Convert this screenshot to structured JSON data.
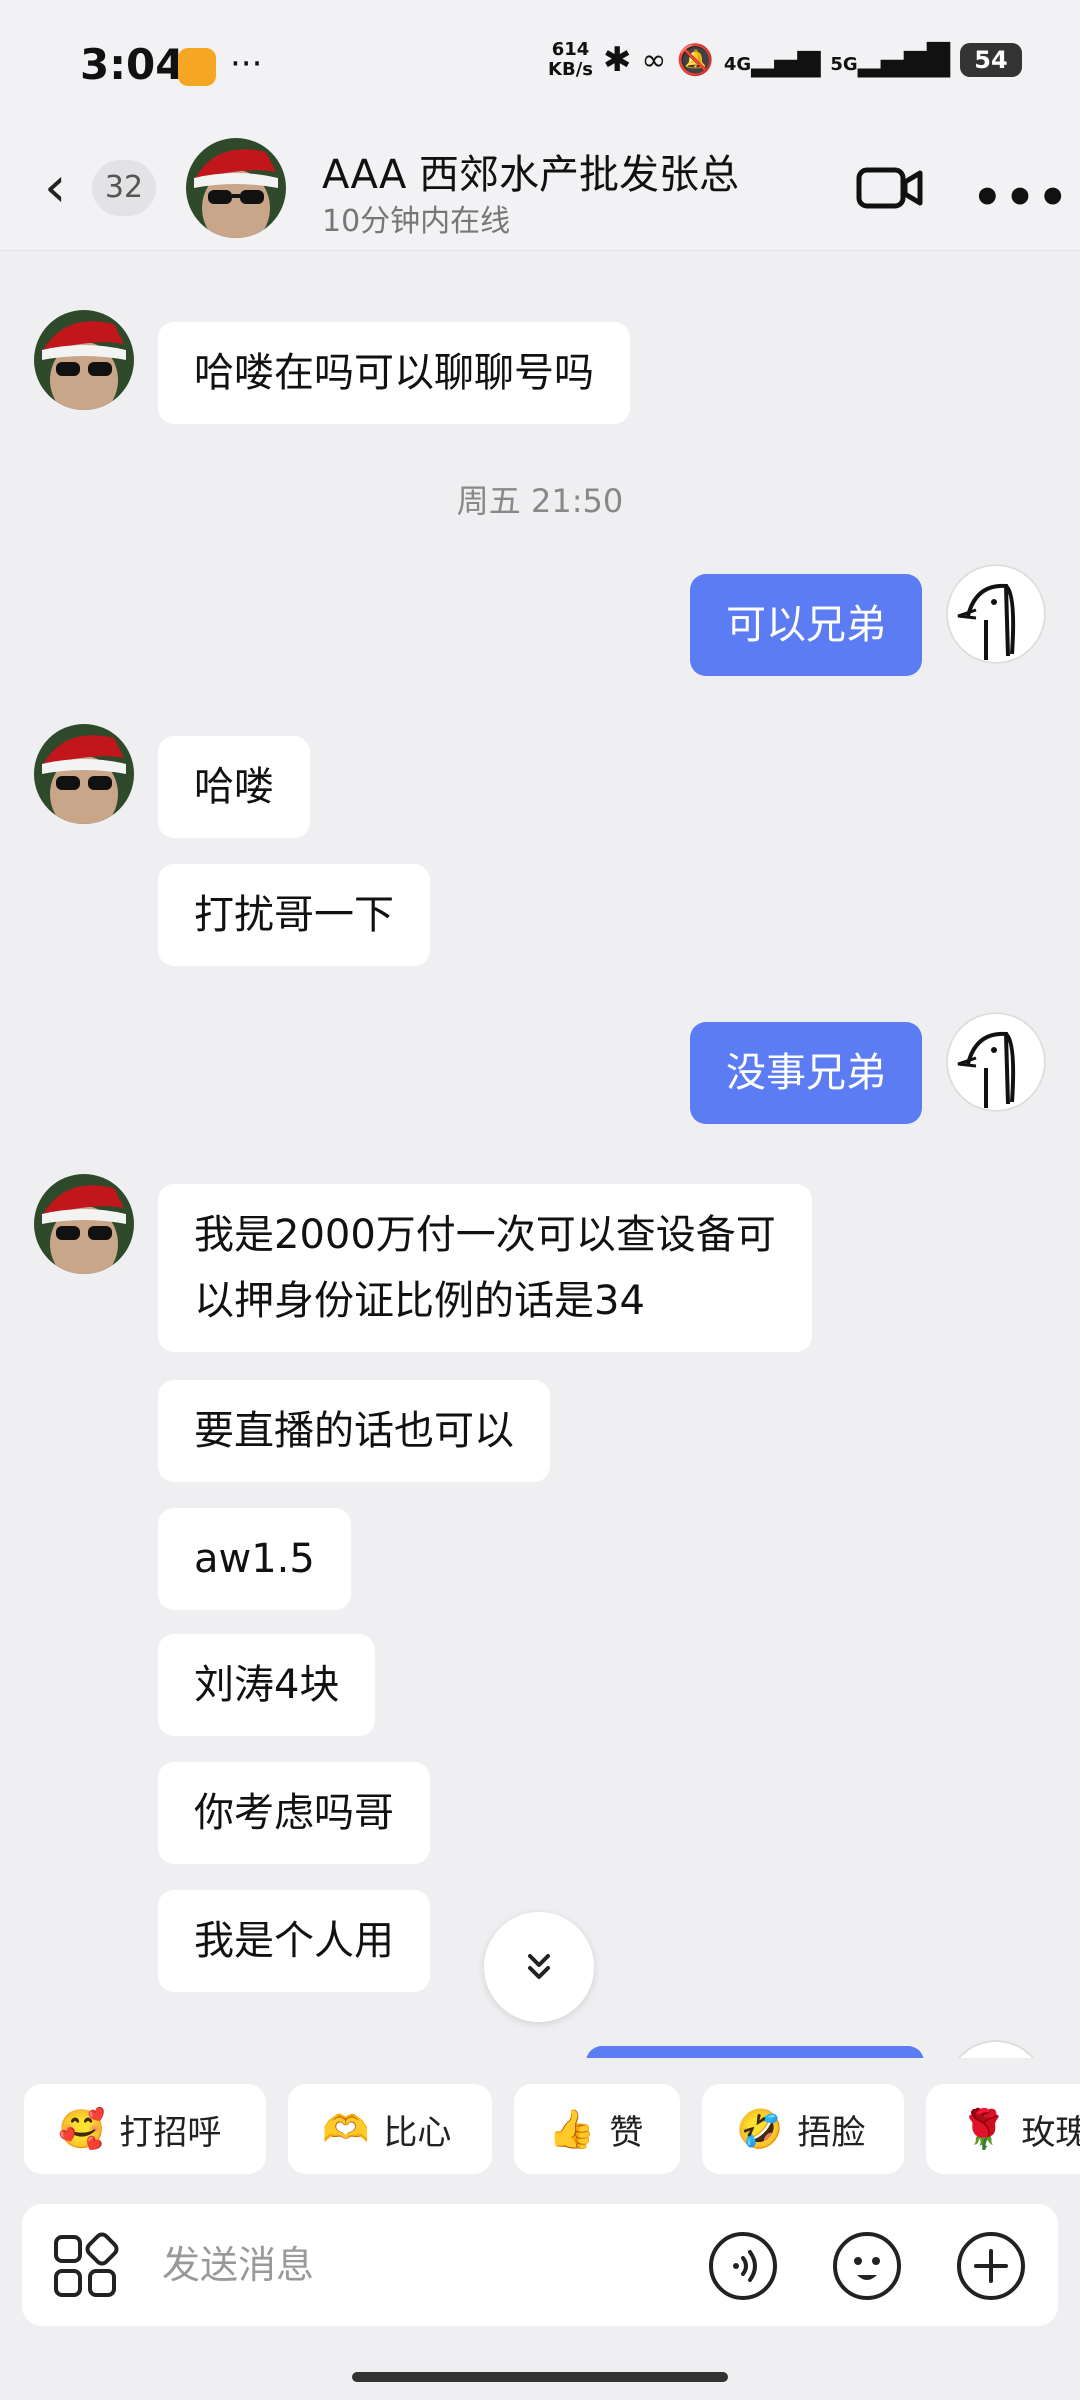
{
  "status_bar": {
    "time": "3:04",
    "net_speed_value": "614",
    "net_speed_unit": "KB/s",
    "signal_labels": [
      "4G",
      "5G"
    ],
    "battery": "54"
  },
  "header": {
    "unread_count": "32",
    "contact_name": "AAA 西郊水产批发张总",
    "contact_status": "10分钟内在线"
  },
  "messages": [
    {
      "id": "m1",
      "side": "left",
      "text": "哈喽在吗可以聊聊号吗"
    },
    {
      "id": "t1",
      "type": "timestamp",
      "text": "周五 21:50"
    },
    {
      "id": "m2",
      "side": "right",
      "text": "可以兄弟"
    },
    {
      "id": "m3",
      "side": "left",
      "text": "哈喽"
    },
    {
      "id": "m4",
      "side": "left",
      "text": "打扰哥一下"
    },
    {
      "id": "m5",
      "side": "right",
      "text": "没事兄弟"
    },
    {
      "id": "m6",
      "side": "left",
      "lines": [
        "我是2000万付一次可以查设备可",
        "以押身份证比例的话是34"
      ]
    },
    {
      "id": "m7",
      "side": "left",
      "text": "要直播的话也可以"
    },
    {
      "id": "m8",
      "side": "left",
      "text": "aw1.5"
    },
    {
      "id": "m9",
      "side": "left",
      "text": "刘涛4块"
    },
    {
      "id": "m10",
      "side": "left",
      "text": "你考虑吗哥"
    },
    {
      "id": "m11",
      "side": "left",
      "text": "我是个人用"
    }
  ],
  "quick_replies": [
    {
      "label": "打招呼",
      "icon": "wave-emoji",
      "emoji": "🥰"
    },
    {
      "label": "比心",
      "icon": "heart-hands-emoji",
      "emoji": "🫶"
    },
    {
      "label": "赞",
      "icon": "thumbs-up-emoji",
      "emoji": "👍"
    },
    {
      "label": "捂脸",
      "icon": "facepalm-emoji",
      "emoji": "🤣"
    },
    {
      "label": "玫瑰",
      "icon": "rose-emoji",
      "emoji": "🌹"
    }
  ],
  "input_bar": {
    "placeholder": "发送消息"
  },
  "colors": {
    "sent_bubble": "#5b7cf3",
    "received_bubble": "#ffffff",
    "background": "#efeff1"
  }
}
